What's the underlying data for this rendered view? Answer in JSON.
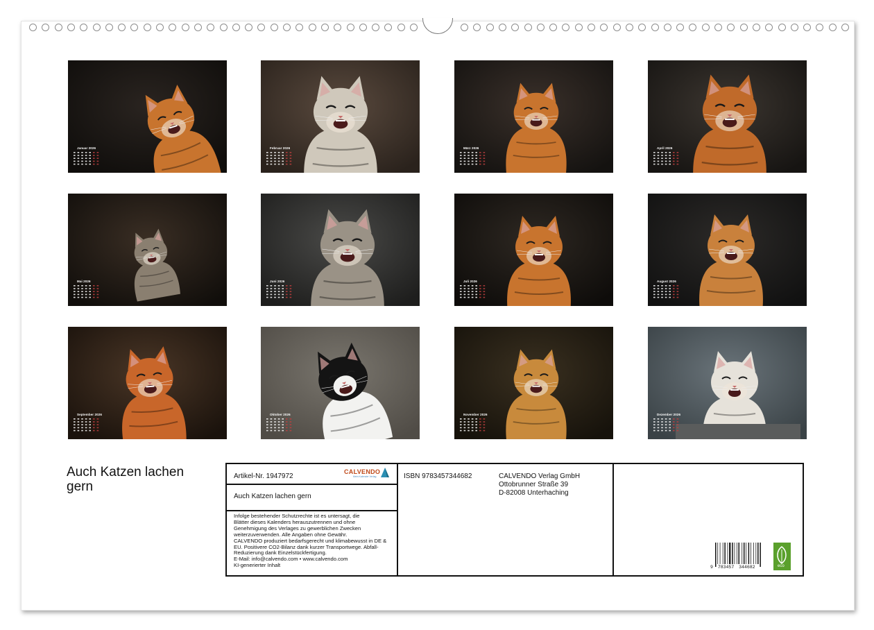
{
  "calendar": {
    "title": "Auch Katzen lachen gern",
    "months": [
      {
        "label": "Januar 2026"
      },
      {
        "label": "Februar 2026"
      },
      {
        "label": "März 2026"
      },
      {
        "label": "April 2026"
      },
      {
        "label": "Mai 2026"
      },
      {
        "label": "Juni 2026"
      },
      {
        "label": "Juli 2026"
      },
      {
        "label": "August 2026"
      },
      {
        "label": "September 2026"
      },
      {
        "label": "Oktober 2026"
      },
      {
        "label": "November 2026"
      },
      {
        "label": "Dezember 2026"
      }
    ]
  },
  "info": {
    "article": "Artikel-Nr. 1947972",
    "brand": "CALVENDO",
    "brand_tagline": "Mein Kalender Verlag",
    "book_title": "Auch Katzen lachen gern",
    "legal": [
      "Infolge bestehender Schutzrechte ist es untersagt, die",
      "Blätter dieses Kalenders herauszutrennen und ohne",
      "Genehmigung des Verlages zu gewerblichen Zwecken",
      "weiterzuverwenden. Alle Angaben ohne Gewähr.",
      "CALVENDO produziert bedarfsgerecht und klimabewusst in DE &",
      "EU. Positivere CO2-Bilanz dank kurzer Transportwege. Abfall-",
      "Reduzierung dank Einzelstückfertigung.",
      "E-Mail: info@calvendo.com • www.calvendo.com",
      "KI-generierter Inhalt"
    ],
    "isbn": "ISBN 9783457344682",
    "publisher": [
      "CALVENDO Verlag GmbH",
      "Ottobrunner Straße 39",
      "D-82008 Unterhaching"
    ],
    "barcode_left": "9",
    "barcode_mid": "783457",
    "barcode_right": "344682",
    "eco_label": "eco"
  },
  "colors": {
    "ginger": "#c8742e",
    "tabby": "#8a7f70",
    "white_cat": "#e6e2da",
    "bw_cat": "#141414",
    "eco_green": "#5aa02c"
  }
}
